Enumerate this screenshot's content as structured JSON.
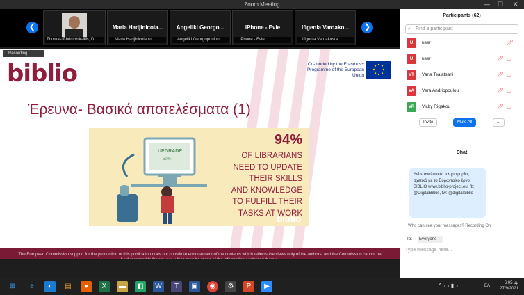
{
  "window": {
    "title": "Zoom Meeting",
    "min": "—",
    "max": "☐",
    "close": "✕"
  },
  "video_strip": {
    "prev": "❮",
    "next": "❯",
    "tiles": [
      {
        "name": "",
        "sub": "Thomas Chrictbhikakis, D..."
      },
      {
        "name": "Maria  Hadjinicola...",
        "sub": "Maria Hadjinicolaou"
      },
      {
        "name": "Angeliki  Georgo...",
        "sub": "Angeliki Georgopoulou"
      },
      {
        "name": "iPhone - Evie",
        "sub": "iPhone - Evie"
      },
      {
        "name": "Ifigenia  Vardako...",
        "sub": "Ifigenia Vardakosta"
      }
    ]
  },
  "recording": "Recording...",
  "slide": {
    "logo": "biblio",
    "cofund": "Co-funded by the Erasmus+ Programme of the European Union",
    "title": "Έρευνα- Βασικά αποτελέσματα (1)",
    "percent": "94%",
    "text_lines": [
      "OF LIBRARIANS",
      "NEED TO UPDATE",
      "THEIR SKILLS",
      "AND KNOWLEDGE",
      "TO FULFILL THEIR",
      "TASKS AT WORK"
    ],
    "screen_word": "UPGRADE",
    "screen_percent": "50%",
    "panel_logo": "biblio",
    "disclaimer": "The European Commission support for the production of this publication does not constitute endorsement of the contents which reflects the views only of the authors, and the Commission cannot be held responsible for any use which may be made of the information contained therein."
  },
  "participants": {
    "title": "Participants (62)",
    "search_placeholder": "Find a participant",
    "list": [
      {
        "initials": "U",
        "name": "user",
        "color": "#d9373c"
      },
      {
        "initials": "U",
        "name": "user",
        "color": "#d9373c"
      },
      {
        "initials": "VT",
        "name": "Vana Tsalatsani",
        "color": "#d9373c"
      },
      {
        "initials": "VA",
        "name": "Vera Andriopoulou",
        "color": "#d9373c"
      },
      {
        "initials": "VR",
        "name": "Vicky Rigakou",
        "color": "#3aa755"
      }
    ],
    "invite": "Invite",
    "mute_all": "Mute All",
    "more": "..."
  },
  "chat": {
    "title": "Chat",
    "message": "Δείτε αναλυτικές πληροφορίες σχετικά με το Ευρωπαϊκό έργο BIBLIO www.biblio-project.eu, fb: @DigitalBiblio, tw: @digitalbiblio",
    "who_can_see": "Who can see your messages? Recording On",
    "to_label": "To:",
    "to_value": "Everyone",
    "placeholder": "Type message here..."
  },
  "taskbar": {
    "lang": "ΕΛ",
    "time": "6:05 μμ",
    "date": "27/9/2021"
  }
}
